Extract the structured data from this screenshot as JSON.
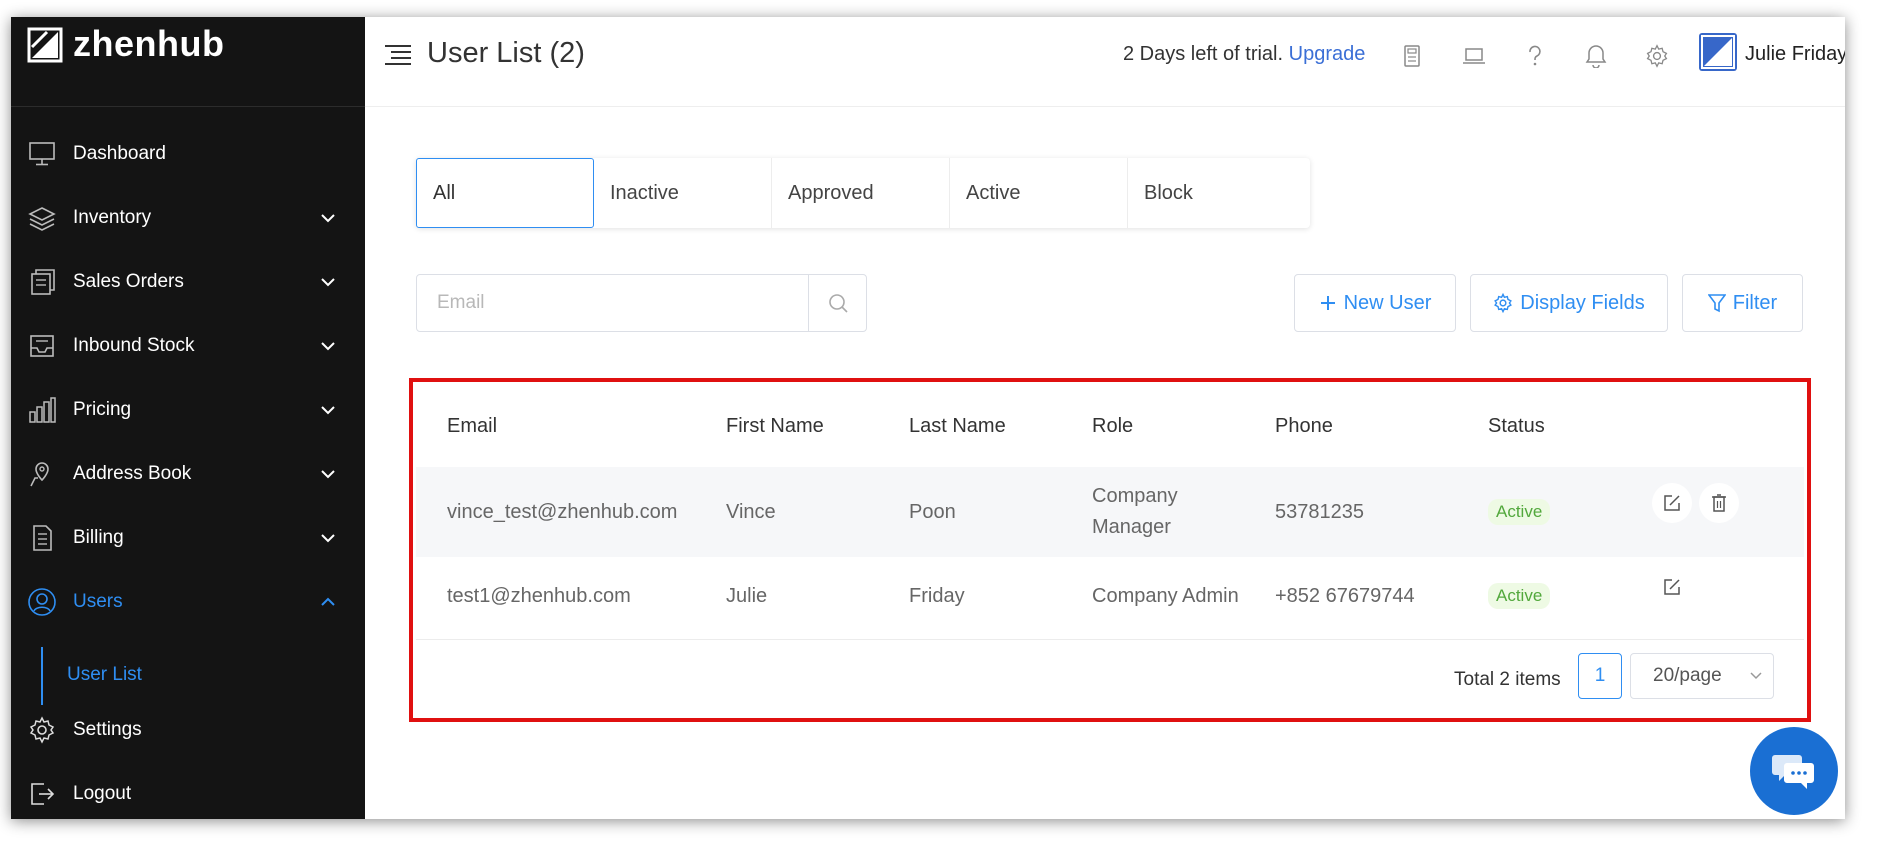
{
  "brand": {
    "name": "zhenhub"
  },
  "sidebar": {
    "items": [
      {
        "label": "Dashboard",
        "icon": "monitor-icon"
      },
      {
        "label": "Inventory",
        "icon": "layers-icon"
      },
      {
        "label": "Sales Orders",
        "icon": "document-stack-icon"
      },
      {
        "label": "Inbound Stock",
        "icon": "inbox-tray-icon"
      },
      {
        "label": "Pricing",
        "icon": "bar-chart-icon"
      },
      {
        "label": "Address Book",
        "icon": "map-pin-icon"
      },
      {
        "label": "Billing",
        "icon": "receipt-icon"
      },
      {
        "label": "Users",
        "icon": "user-circle-icon"
      },
      {
        "label": "Settings",
        "icon": "gear-icon"
      },
      {
        "label": "Logout",
        "icon": "logout-icon"
      }
    ],
    "sub_items": [
      {
        "label": "User List"
      }
    ]
  },
  "header": {
    "title": "User List (2)",
    "trial_text": "2 Days left of trial.",
    "upgrade_label": "Upgrade",
    "username": "Julie Friday"
  },
  "tabs": [
    "All",
    "Inactive",
    "Approved",
    "Active",
    "Block"
  ],
  "search": {
    "placeholder": "Email",
    "value": ""
  },
  "toolbar": {
    "new_user_label": "New User",
    "display_fields_label": "Display Fields",
    "filter_label": "Filter"
  },
  "table": {
    "columns": [
      "Email",
      "First Name",
      "Last Name",
      "Role",
      "Phone",
      "Status"
    ],
    "rows": [
      {
        "email": "vince_test@zhenhub.com",
        "first_name": "Vince",
        "last_name": "Poon",
        "role_line1": "Company",
        "role_line2": "Manager",
        "phone": "53781235",
        "status": "Active"
      },
      {
        "email": "test1@zhenhub.com",
        "first_name": "Julie",
        "last_name": "Friday",
        "role_line1": "Company Admin",
        "role_line2": "",
        "phone": "+852 67679744",
        "status": "Active"
      }
    ]
  },
  "pagination": {
    "total_text": "Total 2 items",
    "current_page": "1",
    "page_size": "20/page"
  },
  "colors": {
    "accent": "#2f8ef2",
    "sidebar_bg": "#141414",
    "status_active": "#52a83c",
    "highlight": "#e01010",
    "chat": "#1a6fd3"
  }
}
